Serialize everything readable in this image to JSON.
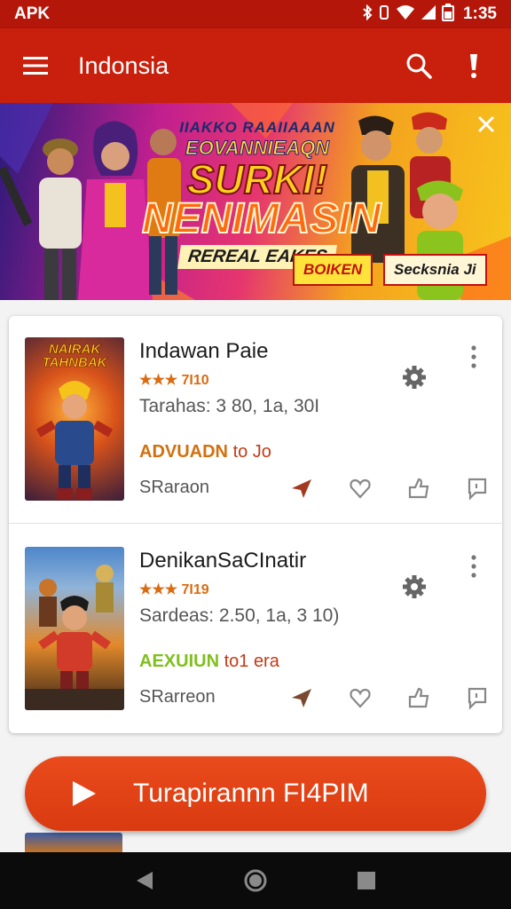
{
  "status_bar": {
    "left_text": "APK",
    "time": "1:35",
    "icons": [
      "bluetooth-icon",
      "vibrate-icon",
      "wifi-icon",
      "signal-icon",
      "battery-icon"
    ]
  },
  "app_bar": {
    "title": "Indonsia",
    "icons": [
      "menu-icon",
      "search-icon",
      "alert-icon"
    ]
  },
  "banner": {
    "line1": "IIAKKO RAAIIAAAN",
    "line2": "EOVANNIEAQN",
    "line3": "SURKI!",
    "line4": "NENIMASIN",
    "line5": "REREAL EAKES",
    "tag_left": "BOIKEN",
    "tag_right": "Secksnia Ji",
    "close_icon": "close-icon"
  },
  "games": [
    {
      "cover_title": "NAIRAK TAHNBAK",
      "title": "Indawan Paie",
      "rating": "★★★ 7I10",
      "meta": "Tarahas: 3 80, 1a, 30I",
      "tag_bold": "ADVUADN",
      "tag_rest": "to Jo",
      "tag_color": "#d2700f",
      "source": "SRaraon"
    },
    {
      "cover_title": "",
      "title": "DenikanSaCInatir",
      "rating": "★★★ 7I19",
      "meta": "Sardeas: 2.50, 1a, 3 10)",
      "tag_bold": "AEXUIUN",
      "tag_rest": "to1 era",
      "tag_color": "#7fbf1e",
      "source": "SRarreon"
    }
  ],
  "cta": {
    "label": "Turapirannn FI4PIM",
    "icon": "play-icon"
  },
  "nav_bar": {
    "icons": [
      "back-icon",
      "home-icon",
      "recents-icon"
    ]
  },
  "colors": {
    "primary": "#c8200d",
    "status_bar": "#b5160a",
    "accent": "#e0461a",
    "nav": "#0b0b0b"
  }
}
